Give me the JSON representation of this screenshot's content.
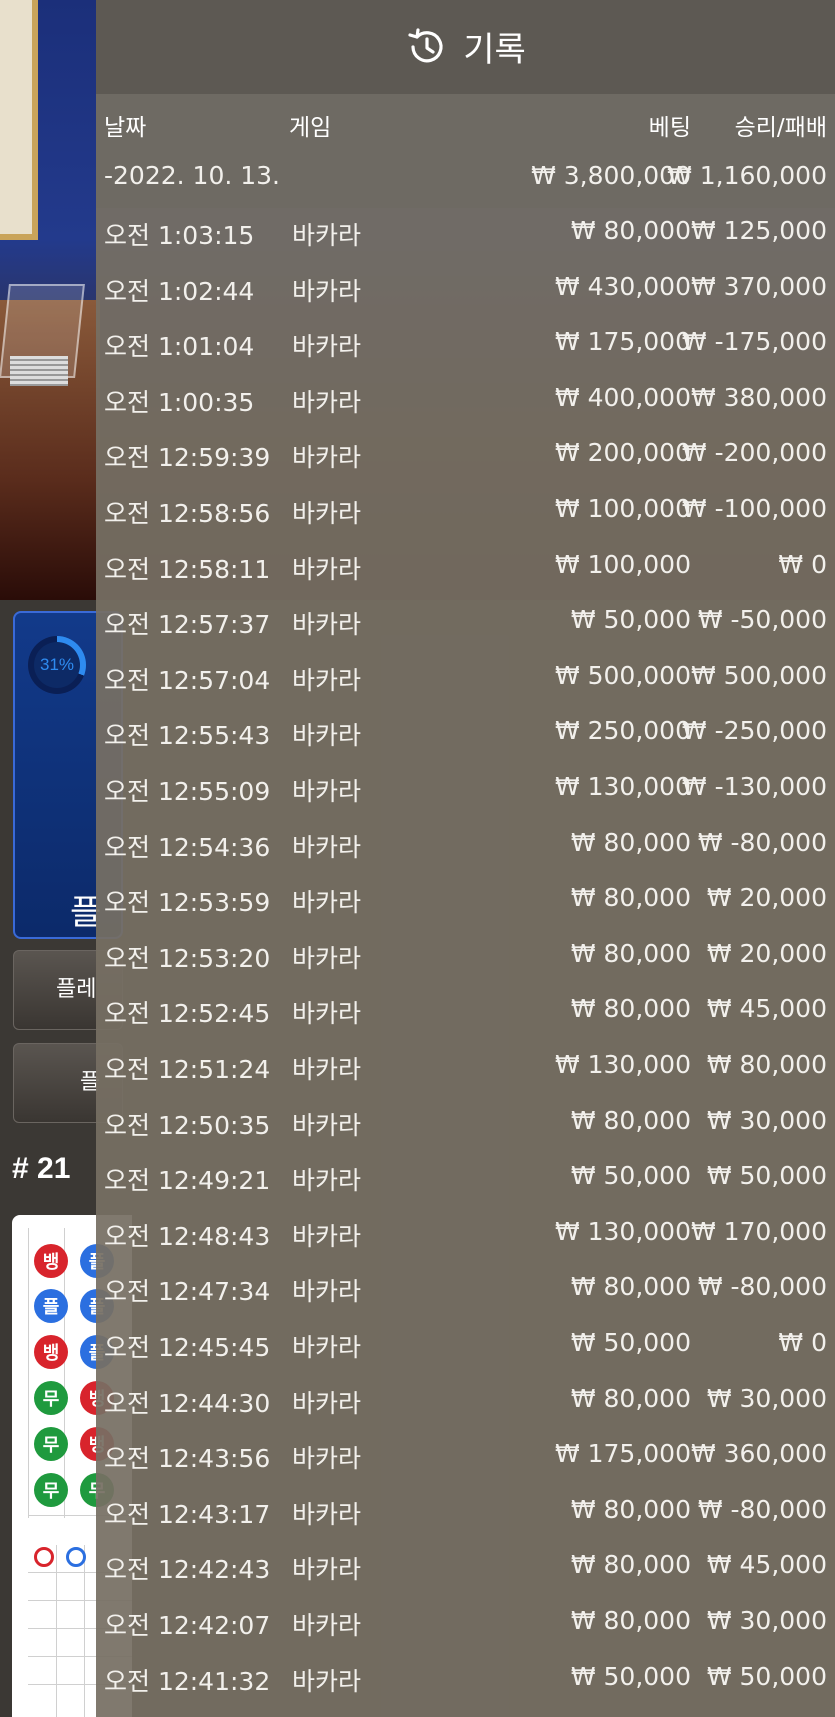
{
  "background": {
    "progress_label": "31%",
    "panel_label": "플",
    "btn_1_label": "플레",
    "btn_2_label": "플",
    "round_label": "# 21",
    "bead_labels": {
      "banker": "뱅",
      "player": "플",
      "tie": "무"
    }
  },
  "history": {
    "title": "기록",
    "columns": {
      "date": "날짜",
      "game": "게임",
      "bet": "베팅",
      "result": "승리/패배"
    },
    "date_summary": {
      "date": "-2022. 10. 13.",
      "bet_total": "₩ 3,800,000",
      "result_total": "₩ 1,160,000"
    },
    "rows": [
      {
        "time": "오전 1:03:15",
        "game": "바카라",
        "bet": "₩ 80,000",
        "result": "₩ 125,000"
      },
      {
        "time": "오전 1:02:44",
        "game": "바카라",
        "bet": "₩ 430,000",
        "result": "₩ 370,000"
      },
      {
        "time": "오전 1:01:04",
        "game": "바카라",
        "bet": "₩ 175,000",
        "result": "₩ -175,000"
      },
      {
        "time": "오전 1:00:35",
        "game": "바카라",
        "bet": "₩ 400,000",
        "result": "₩ 380,000"
      },
      {
        "time": "오전 12:59:39",
        "game": "바카라",
        "bet": "₩ 200,000",
        "result": "₩ -200,000"
      },
      {
        "time": "오전 12:58:56",
        "game": "바카라",
        "bet": "₩ 100,000",
        "result": "₩ -100,000"
      },
      {
        "time": "오전 12:58:11",
        "game": "바카라",
        "bet": "₩ 100,000",
        "result": "₩ 0"
      },
      {
        "time": "오전 12:57:37",
        "game": "바카라",
        "bet": "₩ 50,000",
        "result": "₩ -50,000"
      },
      {
        "time": "오전 12:57:04",
        "game": "바카라",
        "bet": "₩ 500,000",
        "result": "₩ 500,000"
      },
      {
        "time": "오전 12:55:43",
        "game": "바카라",
        "bet": "₩ 250,000",
        "result": "₩ -250,000"
      },
      {
        "time": "오전 12:55:09",
        "game": "바카라",
        "bet": "₩ 130,000",
        "result": "₩ -130,000"
      },
      {
        "time": "오전 12:54:36",
        "game": "바카라",
        "bet": "₩ 80,000",
        "result": "₩ -80,000"
      },
      {
        "time": "오전 12:53:59",
        "game": "바카라",
        "bet": "₩ 80,000",
        "result": "₩ 20,000"
      },
      {
        "time": "오전 12:53:20",
        "game": "바카라",
        "bet": "₩ 80,000",
        "result": "₩ 20,000"
      },
      {
        "time": "오전 12:52:45",
        "game": "바카라",
        "bet": "₩ 80,000",
        "result": "₩ 45,000"
      },
      {
        "time": "오전 12:51:24",
        "game": "바카라",
        "bet": "₩ 130,000",
        "result": "₩ 80,000"
      },
      {
        "time": "오전 12:50:35",
        "game": "바카라",
        "bet": "₩ 80,000",
        "result": "₩ 30,000"
      },
      {
        "time": "오전 12:49:21",
        "game": "바카라",
        "bet": "₩ 50,000",
        "result": "₩ 50,000"
      },
      {
        "time": "오전 12:48:43",
        "game": "바카라",
        "bet": "₩ 130,000",
        "result": "₩ 170,000"
      },
      {
        "time": "오전 12:47:34",
        "game": "바카라",
        "bet": "₩ 80,000",
        "result": "₩ -80,000"
      },
      {
        "time": "오전 12:45:45",
        "game": "바카라",
        "bet": "₩ 50,000",
        "result": "₩ 0"
      },
      {
        "time": "오전 12:44:30",
        "game": "바카라",
        "bet": "₩ 80,000",
        "result": "₩ 30,000"
      },
      {
        "time": "오전 12:43:56",
        "game": "바카라",
        "bet": "₩ 175,000",
        "result": "₩ 360,000"
      },
      {
        "time": "오전 12:43:17",
        "game": "바카라",
        "bet": "₩ 80,000",
        "result": "₩ -80,000"
      },
      {
        "time": "오전 12:42:43",
        "game": "바카라",
        "bet": "₩ 80,000",
        "result": "₩ 45,000"
      },
      {
        "time": "오전 12:42:07",
        "game": "바카라",
        "bet": "₩ 80,000",
        "result": "₩ 30,000"
      },
      {
        "time": "오전 12:41:32",
        "game": "바카라",
        "bet": "₩ 50,000",
        "result": "₩ 50,000"
      }
    ]
  }
}
